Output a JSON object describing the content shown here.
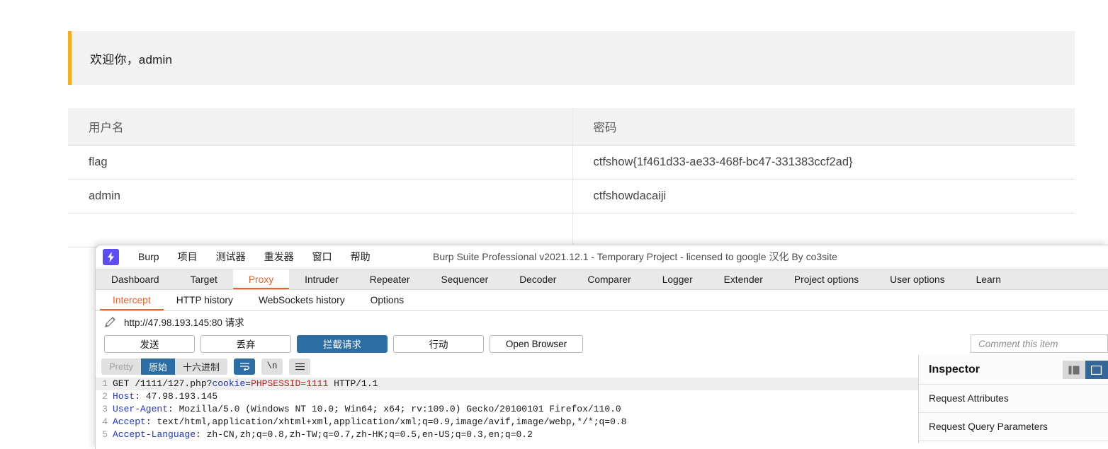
{
  "webpage": {
    "welcome": "欢迎你，admin",
    "table": {
      "columns": [
        "用户名",
        "密码"
      ],
      "rows": [
        {
          "username": "flag",
          "password": "ctfshow{1f461d33-ae33-468f-bc47-331383ccf2ad}"
        },
        {
          "username": "admin",
          "password": "ctfshowdacaiji"
        },
        {
          "username": "",
          "password": ""
        }
      ]
    },
    "accent_color": "#f8ad1c"
  },
  "burp": {
    "logo_icon": "lightning-bolt-icon",
    "menu": [
      "Burp",
      "项目",
      "测试器",
      "重发器",
      "窗口",
      "帮助"
    ],
    "window_title": "Burp Suite Professional v2021.12.1 - Temporary Project - licensed to google 汉化 By co3site",
    "main_tabs": [
      {
        "label": "Dashboard",
        "active": false
      },
      {
        "label": "Target",
        "active": false
      },
      {
        "label": "Proxy",
        "active": true
      },
      {
        "label": "Intruder",
        "active": false
      },
      {
        "label": "Repeater",
        "active": false
      },
      {
        "label": "Sequencer",
        "active": false
      },
      {
        "label": "Decoder",
        "active": false
      },
      {
        "label": "Comparer",
        "active": false
      },
      {
        "label": "Logger",
        "active": false
      },
      {
        "label": "Extender",
        "active": false
      },
      {
        "label": "Project options",
        "active": false
      },
      {
        "label": "User options",
        "active": false
      },
      {
        "label": "Learn",
        "active": false
      }
    ],
    "sub_tabs": [
      {
        "label": "Intercept",
        "active": true
      },
      {
        "label": "HTTP history",
        "active": false
      },
      {
        "label": "WebSockets history",
        "active": false
      },
      {
        "label": "Options",
        "active": false
      }
    ],
    "url_row": {
      "edit_icon": "pencil-icon",
      "text": "http://47.98.193.145:80 请求"
    },
    "buttons": {
      "forward": "发送",
      "drop": "丢弃",
      "intercept": "拦截请求",
      "action": "行动",
      "open_browser": "Open Browser",
      "comment_placeholder": "Comment this item"
    },
    "format_bar": {
      "pretty": "Pretty",
      "raw": "原始",
      "hex": "十六进制",
      "wrap_icon": "word-wrap-icon",
      "newline_label": "\\n",
      "menu_icon": "hamburger-menu-icon"
    },
    "request": {
      "lines": [
        {
          "n": "1",
          "parts": [
            {
              "t": "GET /1111/127.php?",
              "c": "plain"
            },
            {
              "t": "cookie",
              "c": "blue"
            },
            {
              "t": "=",
              "c": "plain"
            },
            {
              "t": "PHPSESSID=1111",
              "c": "red"
            },
            {
              "t": " HTTP/1.1",
              "c": "plain"
            }
          ]
        },
        {
          "n": "2",
          "parts": [
            {
              "t": "Host",
              "c": "blue"
            },
            {
              "t": ": 47.98.193.145",
              "c": "plain"
            }
          ]
        },
        {
          "n": "3",
          "parts": [
            {
              "t": "User-Agent",
              "c": "blue"
            },
            {
              "t": ": Mozilla/5.0 (Windows NT 10.0; Win64; x64; rv:109.0) Gecko/20100101 Firefox/110.0",
              "c": "plain"
            }
          ]
        },
        {
          "n": "4",
          "parts": [
            {
              "t": "Accept",
              "c": "blue"
            },
            {
              "t": ": text/html,application/xhtml+xml,application/xml;q=0.9,image/avif,image/webp,*/*;q=0.8",
              "c": "plain"
            }
          ]
        },
        {
          "n": "5",
          "parts": [
            {
              "t": "Accept-Language",
              "c": "blue"
            },
            {
              "t": ": zh-CN,zh;q=0.8,zh-TW;q=0.7,zh-HK;q=0.5,en-US;q=0.3,en;q=0.2",
              "c": "plain"
            }
          ]
        }
      ]
    },
    "inspector": {
      "title": "Inspector",
      "layout_toggle_vertical_icon": "panel-split-vertical-icon",
      "layout_toggle_horizontal_icon": "panel-split-horizontal-icon",
      "rows": [
        "Request Attributes",
        "Request Query Parameters"
      ]
    },
    "accent_color": "#e8622a",
    "primary_color": "#2c6da4"
  }
}
